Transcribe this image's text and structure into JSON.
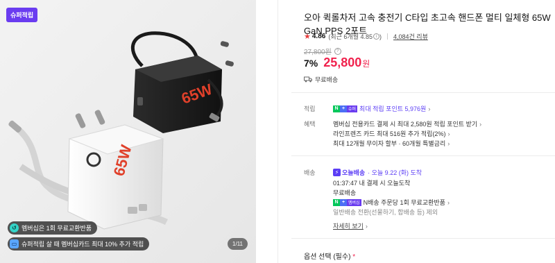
{
  "gallery": {
    "badge": "슈퍼적립",
    "chip_membership": "멤버십은 1회 무료교환반품",
    "chip_card": "슈퍼적립 살 때 멤버십카드 최대 10% 추가 적립",
    "counter": "1/11",
    "product_marking": "65W"
  },
  "product": {
    "title": "오아 퀵롤차저 고속 충전기 C타입 초고속 핸드폰 멀티 일체형 65W GaN PPS 2포트",
    "rating": "4.86",
    "rating_recent": "(최근 6개월 4.85",
    "rating_recent_close": ")",
    "review_count": "4,084건 리뷰",
    "original_price": "27,800원",
    "discount": "7%",
    "price": "25,800",
    "price_unit": "원",
    "shipping_fee": "무료배송"
  },
  "benefits": {
    "point_label": "적립",
    "point_badge_tag": "슈퍼",
    "point_text": "최대 적립 포인트 5,976원",
    "benefit_label": "혜택",
    "benefit_items": [
      "멤버십 전용카드 결제 시 최대 2,580원 적립 포인트 받기",
      "라인프렌즈 카드 최대 516원 추가 적립(2%)",
      "최대 12개월 무이자 할부 · 60개월 특별금리"
    ]
  },
  "delivery": {
    "label": "배송",
    "today_badge": "오늘배송",
    "today_date": "· 오늘 9.22 (화) 도착",
    "cutoff": "01:37:47  내 결제 시 오늘도착",
    "fee": "무료배송",
    "npay_tag": "멤버십",
    "npay_text": "N배송 주문당 1회 무료교환반품",
    "note": "일반배송 전환(선물하기, 합배송 등) 제외",
    "detail_link": "자세히 보기"
  },
  "option": {
    "label": "옵션 선택 (필수)",
    "required_mark": "*"
  },
  "colors": {
    "price_red": "#f0224d",
    "brand_purple": "#5b3df5",
    "npay_green": "#03c75a"
  }
}
